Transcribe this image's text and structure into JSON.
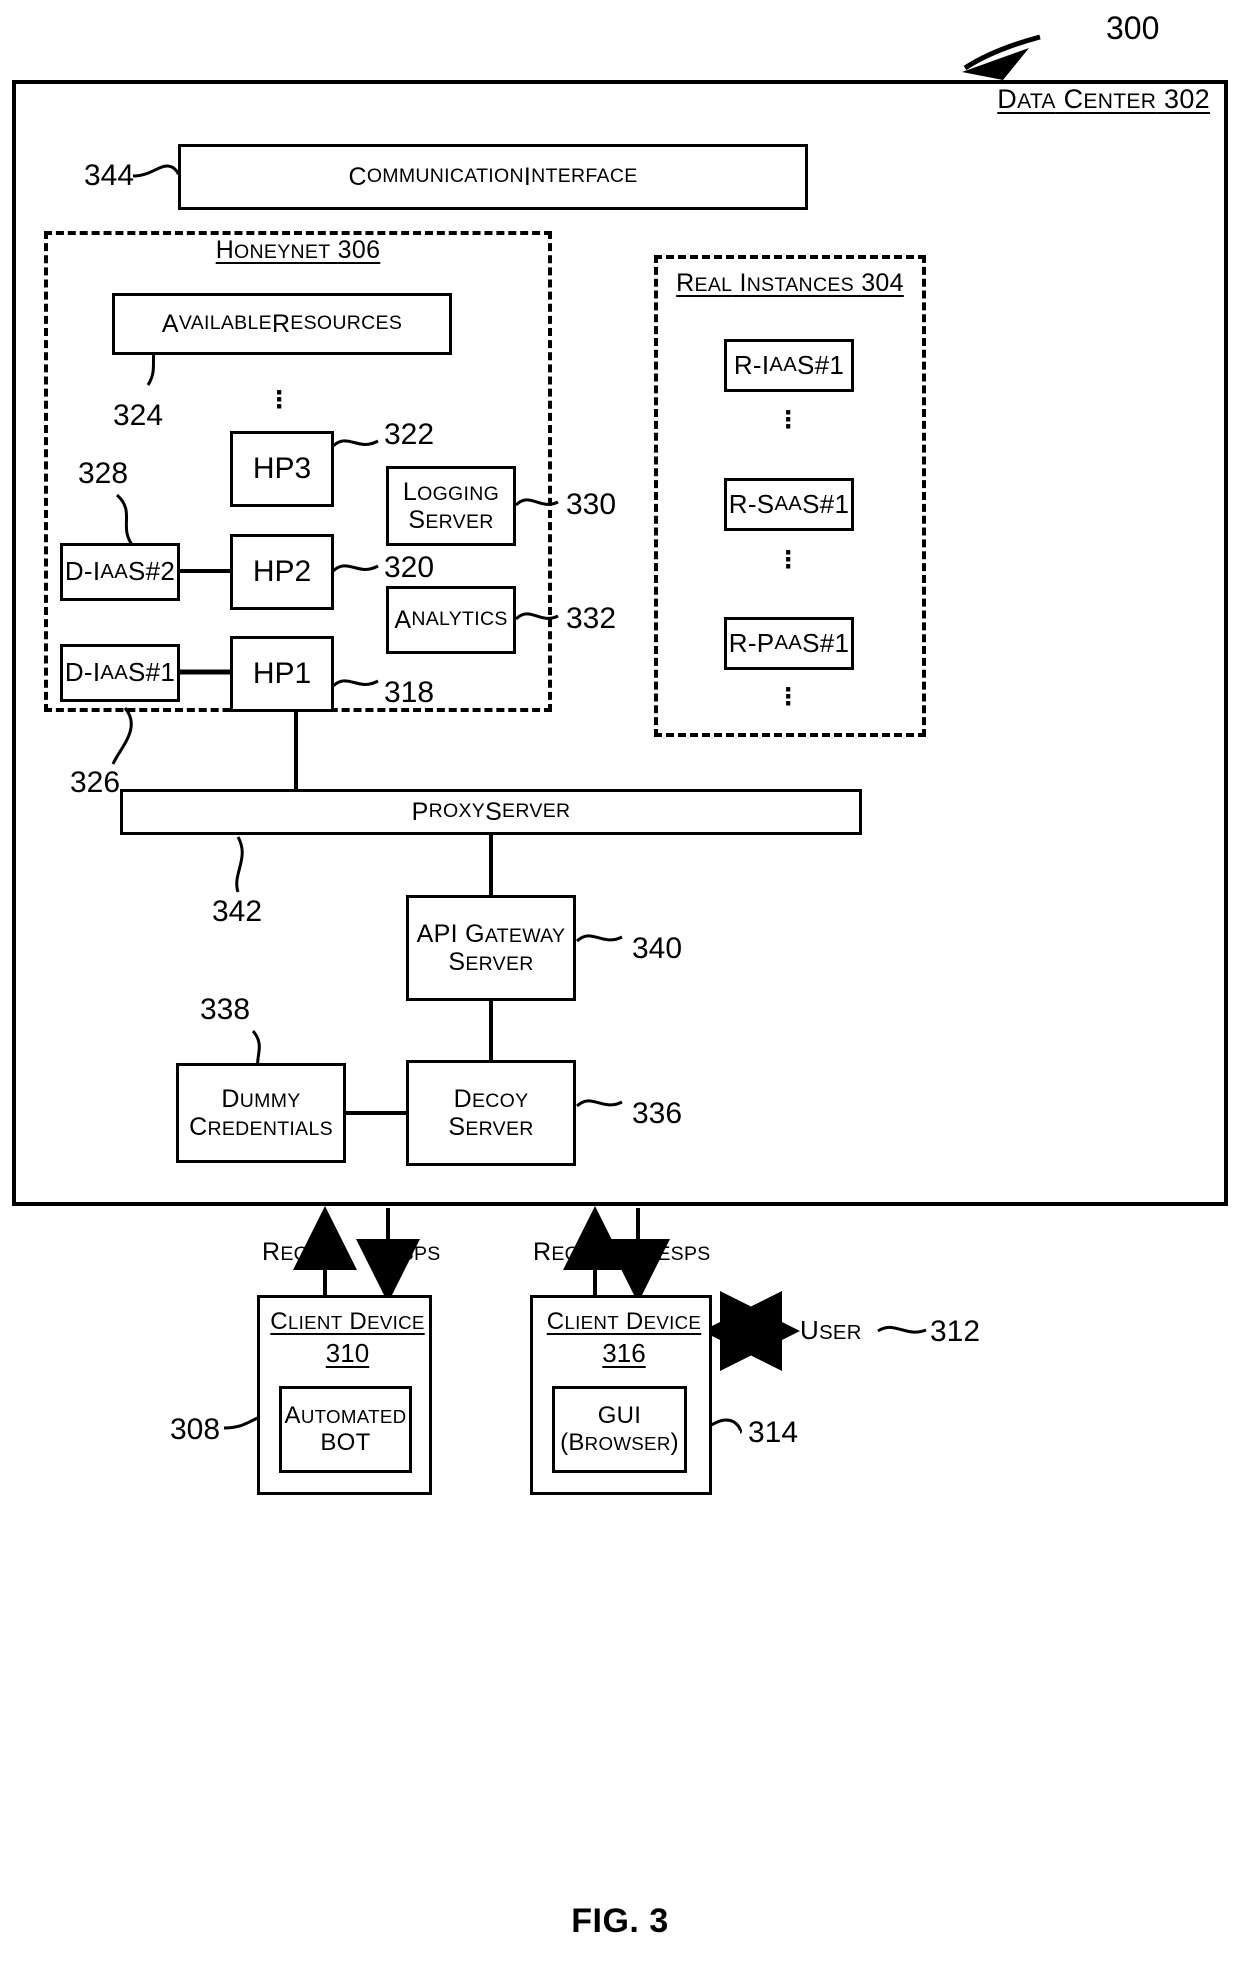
{
  "figure": {
    "caption": "FIG. 3",
    "system_ref": "300"
  },
  "data_center": {
    "title": "Data Center",
    "ref": "302"
  },
  "communication_interface": {
    "label": "Communication Interface",
    "ref": "344"
  },
  "honeynet": {
    "title": "Honeynet",
    "ref": "306",
    "available_resources": {
      "label": "Available Resources",
      "ref": "324"
    },
    "honeypots": [
      {
        "label": "HP3",
        "ref": "322"
      },
      {
        "label": "HP2",
        "ref": "320"
      },
      {
        "label": "HP1",
        "ref": "318"
      }
    ],
    "decoy_instances": [
      {
        "label": "D-IaaS#2",
        "ref": "328"
      },
      {
        "label": "D-IaaS#1",
        "ref": "326"
      }
    ],
    "logging_server": {
      "label_line1": "Logging",
      "label_line2": "Server",
      "ref": "330"
    },
    "analytics": {
      "label": "Analytics",
      "ref": "332"
    },
    "ellipsis": "⋮"
  },
  "real_instances": {
    "title": "Real Instances",
    "ref": "304",
    "items": [
      {
        "label": "R-IaaS#1"
      },
      {
        "label": "R-SaaS#1"
      },
      {
        "label": "R-PaaS#1"
      }
    ]
  },
  "proxy_server": {
    "label": "Proxy Server",
    "ref": "342"
  },
  "api_gateway_server": {
    "label_line1": "API Gateway",
    "label_line2": "Server",
    "ref": "340"
  },
  "decoy_server": {
    "label_line1": "Decoy",
    "label_line2": "Server",
    "ref": "336"
  },
  "dummy_credentials": {
    "label_line1": "Dummy",
    "label_line2": "Credentials",
    "ref": "338"
  },
  "flows": {
    "reqs_left": "Reqs",
    "resps_left": "Resps",
    "reqs_right": "Reqs",
    "resps_right": "Resps"
  },
  "client_device_left": {
    "title": "Client Device",
    "ref": "310",
    "inner": {
      "label_line1": "Automated",
      "label_line2": "BOT",
      "ref": "308"
    }
  },
  "client_device_right": {
    "title": "Client Device",
    "ref": "316",
    "inner": {
      "label_line1": "GUI",
      "label_line2": "(Browser)",
      "ref": "314"
    }
  },
  "user": {
    "label": "User",
    "ref": "312"
  },
  "colors": {
    "stroke": "#000000",
    "background": "#ffffff"
  }
}
